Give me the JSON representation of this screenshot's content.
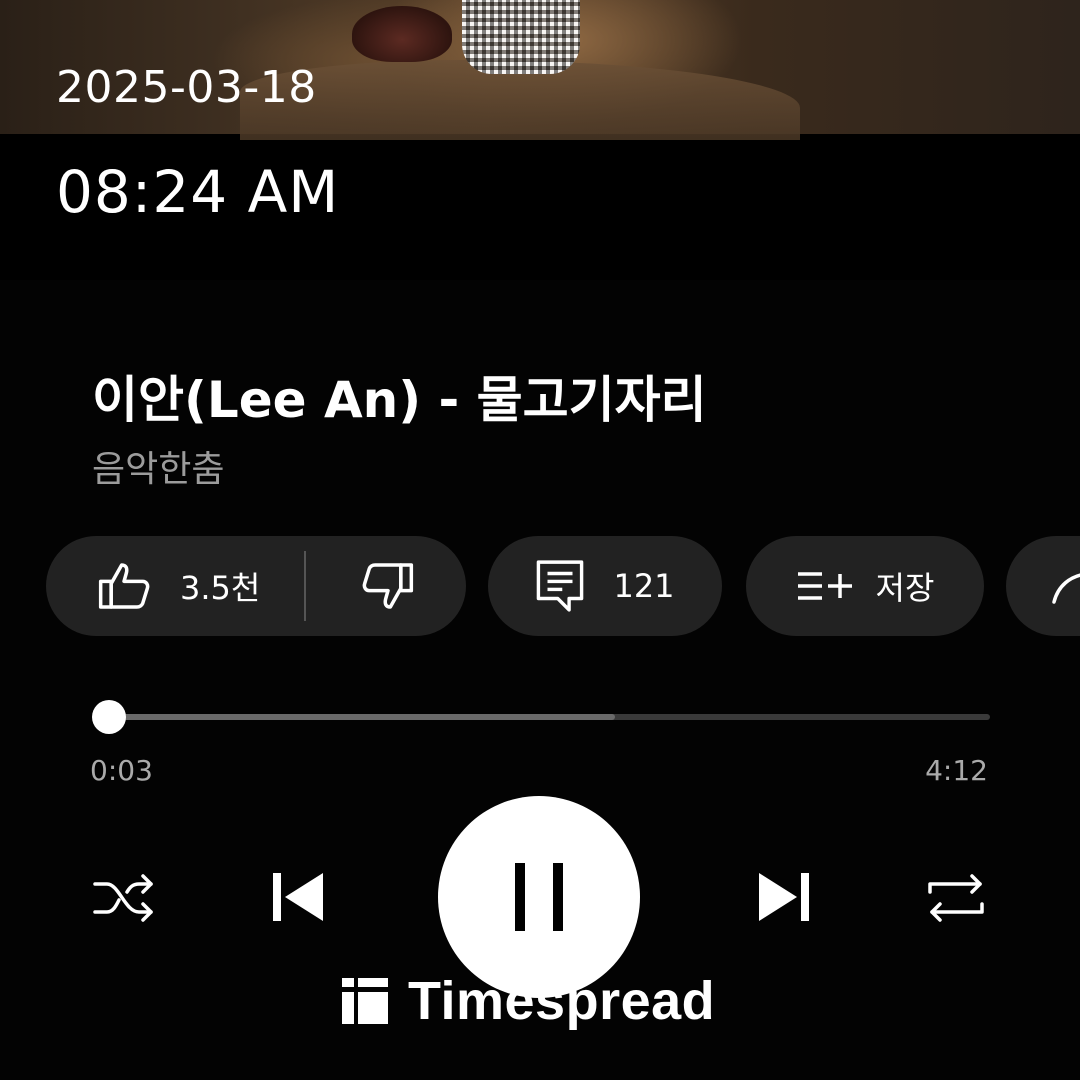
{
  "status": {
    "date": "2025-03-18",
    "time": "08:24 AM"
  },
  "track": {
    "title": "이안(Lee An) - 물고기자리",
    "channel": "음악한춤"
  },
  "actions": {
    "like_count": "3.5천",
    "comment_count": "121",
    "save_label": "저장"
  },
  "playback": {
    "current_time": "0:03",
    "total_time": "4:12",
    "progress_fraction": 0.012,
    "buffered_fraction": 0.58,
    "state": "playing"
  },
  "icons": {
    "like": "thumbs-up-icon",
    "dislike": "thumbs-down-icon",
    "comment": "comment-icon",
    "save": "playlist-add-icon",
    "share": "share-icon",
    "shuffle": "shuffle-icon",
    "previous": "skip-previous-icon",
    "pause": "pause-icon",
    "next": "skip-next-icon",
    "repeat": "repeat-icon"
  },
  "watermark": {
    "text": "Timespread"
  },
  "colors": {
    "background": "#000000",
    "pill": "#222222",
    "secondary_text": "#9c9c9c"
  }
}
